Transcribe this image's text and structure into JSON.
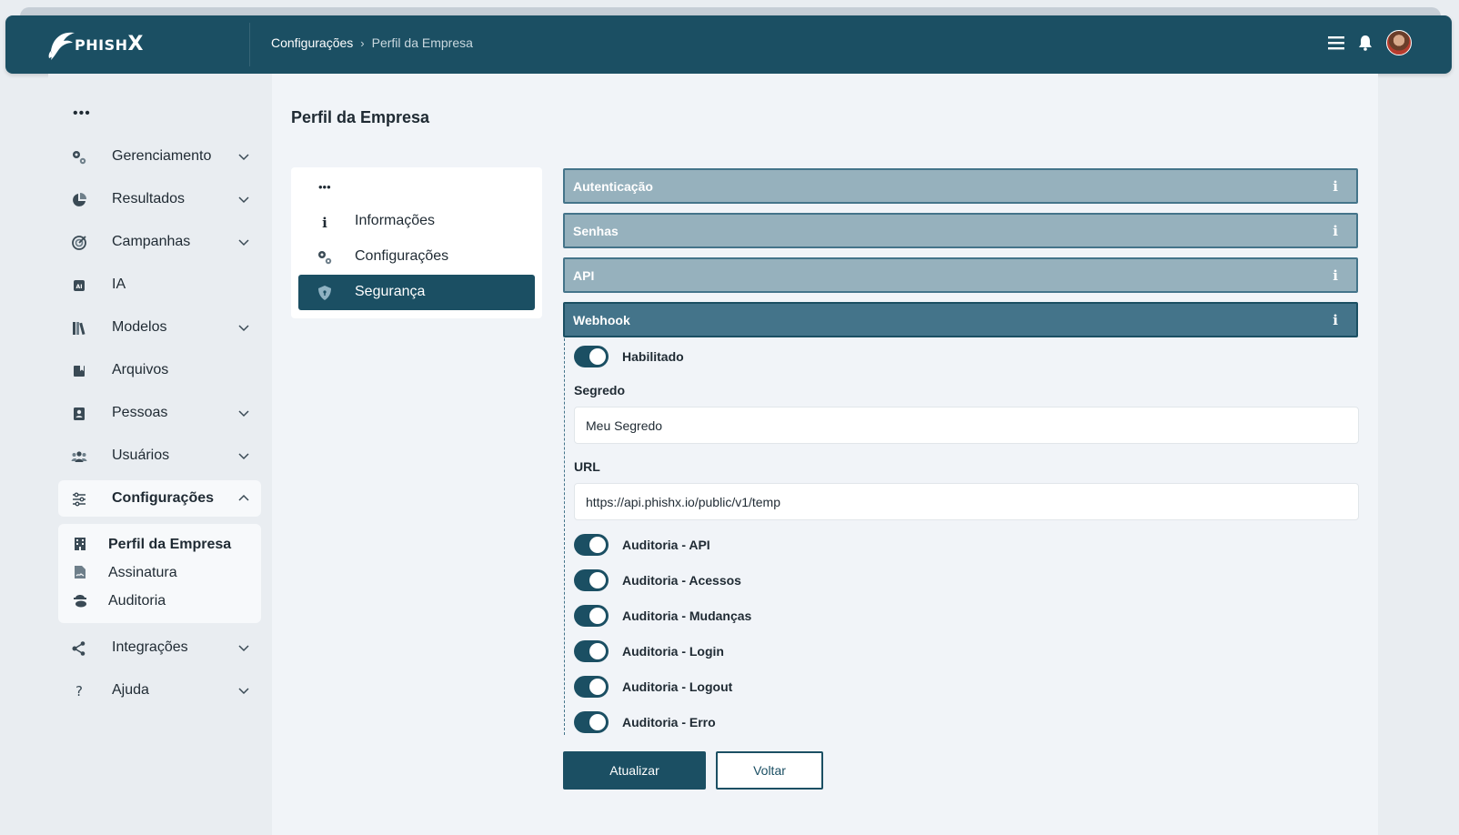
{
  "app": {
    "brand": {
      "name_prefix": "PHISH",
      "name_suffix": "X"
    },
    "breadcrumb": {
      "parent": "Configurações",
      "separator": "›",
      "current": "Perfil da Empresa"
    },
    "header_icons": [
      "menu-icon",
      "bell-icon",
      "user-avatar"
    ]
  },
  "sidebar": {
    "more_dots": "•••",
    "items": [
      {
        "label": "Gerenciamento",
        "icon": "gears-icon",
        "expandable": true
      },
      {
        "label": "Resultados",
        "icon": "pie-chart-icon",
        "expandable": true
      },
      {
        "label": "Campanhas",
        "icon": "target-icon",
        "expandable": true
      },
      {
        "label": "IA",
        "icon": "ai-chip-icon",
        "expandable": false
      },
      {
        "label": "Modelos",
        "icon": "books-icon",
        "expandable": true
      },
      {
        "label": "Arquivos",
        "icon": "bookmark-book-icon",
        "expandable": false
      },
      {
        "label": "Pessoas",
        "icon": "id-card-icon",
        "expandable": true
      },
      {
        "label": "Usuários",
        "icon": "users-icon",
        "expandable": true
      },
      {
        "label": "Configurações",
        "icon": "sliders-icon",
        "expandable": true,
        "active": true
      },
      {
        "label": "Integrações",
        "icon": "share-nodes-icon",
        "expandable": true
      },
      {
        "label": "Ajuda",
        "icon": "question-icon",
        "expandable": true
      }
    ],
    "sub_items": [
      {
        "label": "Perfil da Empresa",
        "icon": "building-icon",
        "active": true
      },
      {
        "label": "Assinatura",
        "icon": "file-signature-icon"
      },
      {
        "label": "Auditoria",
        "icon": "user-secret-icon"
      }
    ]
  },
  "main": {
    "title": "Perfil da Empresa",
    "tabs": {
      "more_dots": "•••",
      "items": [
        {
          "label": "Informações",
          "icon": "info-icon"
        },
        {
          "label": "Configurações",
          "icon": "gears-icon"
        },
        {
          "label": "Segurança",
          "icon": "shield-icon",
          "active": true
        }
      ]
    },
    "accordion": [
      {
        "label": "Autenticação",
        "info": "i",
        "open": false
      },
      {
        "label": "Senhas",
        "info": "i",
        "open": false
      },
      {
        "label": "API",
        "info": "i",
        "open": false
      },
      {
        "label": "Webhook",
        "info": "i",
        "open": true
      }
    ],
    "webhook": {
      "enabled_label": "Habilitado",
      "enabled": true,
      "secret_label": "Segredo",
      "secret_value": "Meu Segredo",
      "url_label": "URL",
      "url_value": "https://api.phishx.io/public/v1/temp",
      "audit_toggles": [
        {
          "label": "Auditoria - API",
          "on": true
        },
        {
          "label": "Auditoria - Acessos",
          "on": true
        },
        {
          "label": "Auditoria - Mudanças",
          "on": true
        },
        {
          "label": "Auditoria - Login",
          "on": true
        },
        {
          "label": "Auditoria - Logout",
          "on": true
        },
        {
          "label": "Auditoria - Erro",
          "on": true
        }
      ]
    },
    "actions": {
      "update_label": "Atualizar",
      "back_label": "Voltar"
    }
  },
  "colors": {
    "primary": "#1b4f63",
    "accordion_collapsed": "#96b1bd",
    "accordion_open": "#44748a",
    "background": "#f1f4f8"
  }
}
